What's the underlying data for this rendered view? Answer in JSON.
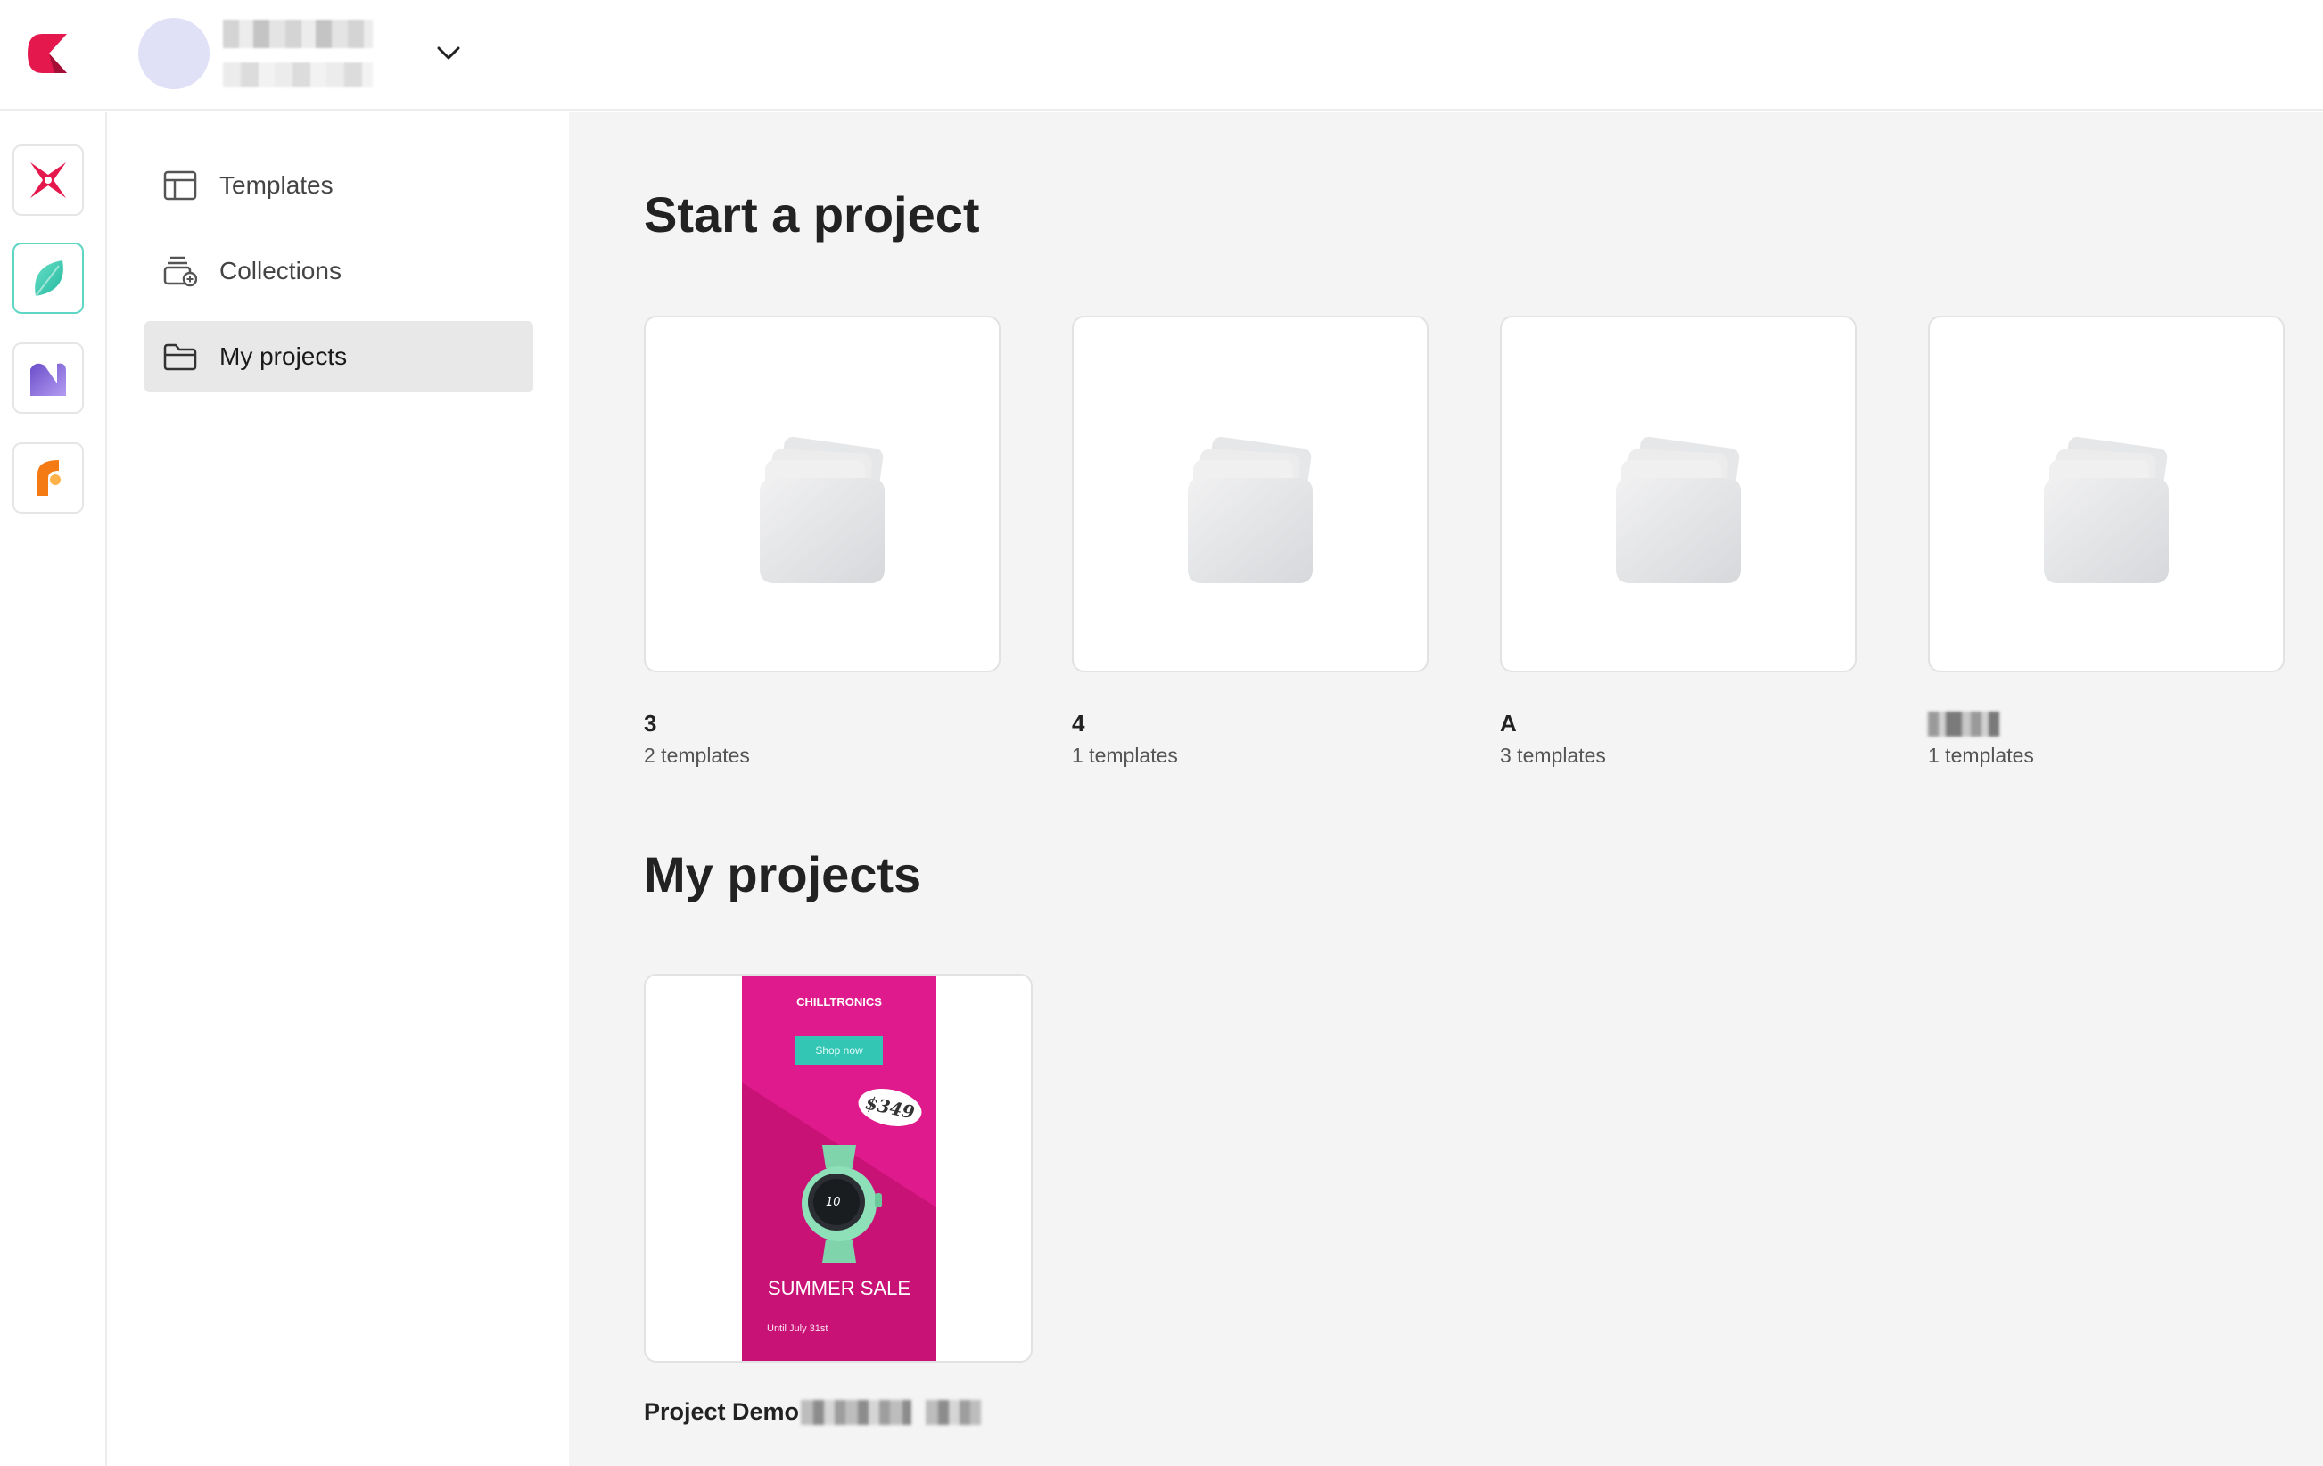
{
  "header": {
    "account_name": "",
    "colors": {
      "avatar": "#e0e1f7",
      "logo": "#e5184d"
    }
  },
  "app_rail": {
    "items": [
      {
        "name": "app-1",
        "color": "#e5184d"
      },
      {
        "name": "app-2",
        "color": "#3ccfb5",
        "active": true
      },
      {
        "name": "app-3",
        "color": "#8563d6"
      },
      {
        "name": "app-4",
        "color": "#f47b13"
      }
    ]
  },
  "sidebar": {
    "items": [
      {
        "label": "Templates",
        "icon": "template-icon"
      },
      {
        "label": "Collections",
        "icon": "collections-icon"
      },
      {
        "label": "My projects",
        "icon": "folder-icon",
        "active": true
      }
    ]
  },
  "main": {
    "start_title": "Start a project",
    "templates": [
      {
        "name": "3",
        "count": "2 templates"
      },
      {
        "name": "4",
        "count": "1 templates"
      },
      {
        "name": "A",
        "count": "3 templates"
      },
      {
        "name": "",
        "count": "1 templates"
      }
    ],
    "projects_title": "My projects",
    "projects": [
      {
        "name": "Project Demo",
        "thumbnail": {
          "brand": "CHILLTRONICS",
          "button": "Shop now",
          "price": "$349",
          "watch_display": "10",
          "headline": "SUMMER SALE",
          "subline": "Until July 31st",
          "colors": {
            "background": "#df1a8c",
            "accent": "#33c6b5",
            "watch": "#8ee0b8"
          }
        }
      }
    ]
  }
}
